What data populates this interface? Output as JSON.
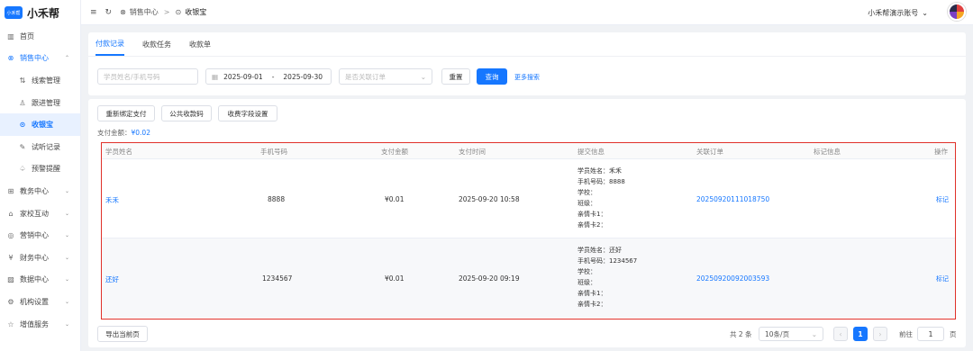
{
  "brand": {
    "badge": "小禾帮",
    "name": "小禾帮"
  },
  "sidebar": {
    "items": [
      {
        "label": "首页",
        "icon": "bar-chart-icon",
        "glyph": "▥"
      },
      {
        "label": "销售中心",
        "icon": "sales-icon",
        "glyph": "⊗",
        "chev": "⌃"
      },
      {
        "label": "线索管理",
        "icon": "clue-icon",
        "glyph": "⇅"
      },
      {
        "label": "跟进管理",
        "icon": "user-icon",
        "glyph": "♙"
      },
      {
        "label": "收银宝",
        "icon": "cashier-icon",
        "glyph": "⊙"
      },
      {
        "label": "试听记录",
        "icon": "trial-icon",
        "glyph": "✎"
      },
      {
        "label": "预警提醒",
        "icon": "bell-icon",
        "glyph": "♤"
      },
      {
        "label": "教务中心",
        "icon": "edu-icon",
        "glyph": "⊞",
        "chev": "⌄"
      },
      {
        "label": "家校互动",
        "icon": "home-school-icon",
        "glyph": "⌂",
        "chev": "⌄"
      },
      {
        "label": "营销中心",
        "icon": "marketing-icon",
        "glyph": "◎",
        "chev": "⌄"
      },
      {
        "label": "财务中心",
        "icon": "finance-icon",
        "glyph": "¥",
        "chev": "⌄"
      },
      {
        "label": "数据中心",
        "icon": "data-icon",
        "glyph": "▨",
        "chev": "⌄"
      },
      {
        "label": "机构设置",
        "icon": "settings-icon",
        "glyph": "⚙",
        "chev": "⌄"
      },
      {
        "label": "增值服务",
        "icon": "star-icon",
        "glyph": "☆",
        "chev": "⌄"
      }
    ]
  },
  "topbar": {
    "menu_glyph": "≡",
    "refresh_glyph": "↻",
    "crumb_parent": "销售中心",
    "crumb_parent_glyph": "⊗",
    "crumb_sep": ">",
    "crumb_current": "收银宝",
    "crumb_current_glyph": "⊙",
    "account": "小禾帮演示账号",
    "account_chev": "⌄"
  },
  "tabs": [
    {
      "label": "付款记录"
    },
    {
      "label": "收款任务"
    },
    {
      "label": "收款单"
    }
  ],
  "filters": {
    "name_placeholder": "学员姓名/手机号码",
    "date_glyph": "▦",
    "date_start": "2025-09-01",
    "date_sep": "-",
    "date_end": "2025-09-30",
    "order_placeholder": "是否关联订单",
    "order_chev": "⌄",
    "reset": "重置",
    "search": "查询",
    "more": "更多搜索"
  },
  "actions": {
    "rebind": "重新绑定支付",
    "public_code": "公共收款码",
    "field_settings": "收费字段设置"
  },
  "summary": {
    "label": "支付金额：",
    "value": "¥0.02"
  },
  "table": {
    "headers": [
      "学员姓名",
      "手机号码",
      "支付金额",
      "支付时间",
      "提交信息",
      "关联订单",
      "标记信息",
      "操作"
    ],
    "rows": [
      {
        "name": "禾禾",
        "phone": "8888",
        "amount": "¥0.01",
        "time": "2025-09-20 10:58",
        "info": [
          "学员姓名：禾禾",
          "手机号码：8888",
          "学校：",
          "班级：",
          "亲情卡1：",
          "亲情卡2："
        ],
        "order": "20250920111018750",
        "mark": "",
        "action": "标记"
      },
      {
        "name": "还好",
        "phone": "1234567",
        "amount": "¥0.01",
        "time": "2025-09-20 09:19",
        "info": [
          "学员姓名：还好",
          "手机号码：1234567",
          "学校：",
          "班级：",
          "亲情卡1：",
          "亲情卡2："
        ],
        "order": "20250920092003593",
        "mark": "",
        "action": "标记"
      }
    ]
  },
  "footer": {
    "export": "导出当前页",
    "total": "共 2 条",
    "page_size": "10条/页",
    "page_size_chev": "⌄",
    "prev": "‹",
    "page": "1",
    "next": "›",
    "goto": "前往",
    "goto_value": "1",
    "page_unit": "页"
  },
  "colors": {
    "accent": "#1677ff",
    "highlight_border": "#e0312a"
  }
}
